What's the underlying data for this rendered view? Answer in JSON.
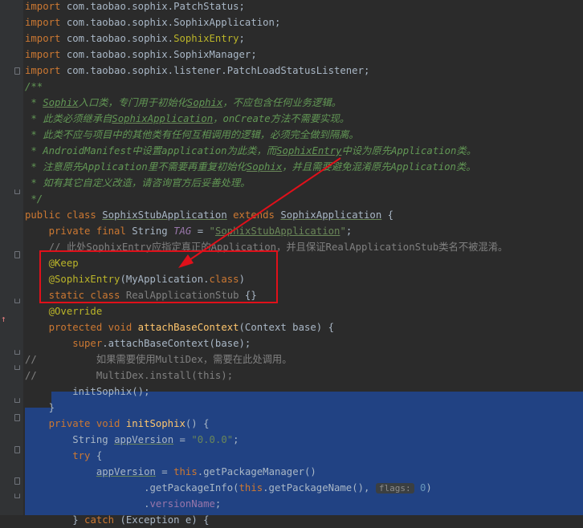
{
  "editor": {
    "lines": [
      {
        "parts": [
          [
            "kw",
            "import"
          ],
          [
            "",
            " com.taobao.sophix.PatchStatus;"
          ]
        ]
      },
      {
        "parts": [
          [
            "kw",
            "import"
          ],
          [
            "",
            " com.taobao.sophix.SophixApplication;"
          ]
        ]
      },
      {
        "parts": [
          [
            "kw",
            "import"
          ],
          [
            "",
            " com.taobao.sophix."
          ],
          [
            "ann",
            "SophixEntry"
          ],
          [
            "",
            ";"
          ]
        ]
      },
      {
        "parts": [
          [
            "kw",
            "import"
          ],
          [
            "",
            " com.taobao.sophix.SophixManager;"
          ]
        ]
      },
      {
        "parts": [
          [
            "kw",
            "import"
          ],
          [
            "",
            " com.taobao.sophix.listener.PatchLoadStatusListener;"
          ]
        ]
      },
      {
        "parts": [
          [
            "doc",
            "/**"
          ]
        ]
      },
      {
        "parts": [
          [
            "doc",
            " * "
          ],
          [
            "doc ul",
            "Sophix"
          ],
          [
            "doc",
            "入口类，专门用于初始化"
          ],
          [
            "doc ul",
            "Sophix"
          ],
          [
            "doc",
            "，不应包含任何业务逻辑。"
          ]
        ]
      },
      {
        "parts": [
          [
            "doc",
            " * 此类必须继承自"
          ],
          [
            "doc ul",
            "SophixApplication"
          ],
          [
            "doc",
            "，onCreate方法不需要实现。"
          ]
        ]
      },
      {
        "parts": [
          [
            "doc",
            " * 此类不应与项目中的其他类有任何互相调用的逻辑，必须完全做到隔离。"
          ]
        ]
      },
      {
        "parts": [
          [
            "doc",
            " * AndroidManifest中设置application为此类，而"
          ],
          [
            "doc ul",
            "SophixEntry"
          ],
          [
            "doc",
            "中设为原先Application类。"
          ]
        ]
      },
      {
        "parts": [
          [
            "doc",
            " * 注意原先Application里不需要再重复初始化"
          ],
          [
            "doc ul",
            "Sophix"
          ],
          [
            "doc",
            "，并且需要避免混淆原先Application类。"
          ]
        ]
      },
      {
        "parts": [
          [
            "doc",
            " * 如有其它自定义改造，请咨询官方后妥善处理。"
          ]
        ]
      },
      {
        "parts": [
          [
            "doc",
            " */"
          ]
        ]
      },
      {
        "parts": [
          [
            "kw",
            "public class "
          ],
          [
            "ul",
            "SophixStubApplication"
          ],
          [
            "kw",
            " extends "
          ],
          [
            "ul",
            "SophixApplication"
          ],
          [
            "",
            " {"
          ]
        ]
      },
      {
        "parts": [
          [
            "",
            "    "
          ],
          [
            "kw",
            "private final "
          ],
          [
            "",
            "String "
          ],
          [
            "fldi",
            "TAG"
          ],
          [
            "",
            " = "
          ],
          [
            "str",
            "\""
          ],
          [
            "str ul",
            "SophixStubApplication"
          ],
          [
            "str",
            "\""
          ],
          [
            "",
            ";"
          ]
        ]
      },
      {
        "parts": [
          [
            "cmt",
            "    // 此处"
          ],
          [
            "cmt ul",
            "SophixEntry"
          ],
          [
            "cmt",
            "应指定真正的Application，并且保证RealApplicationStub类名不被混淆。"
          ]
        ]
      },
      {
        "parts": [
          [
            "ann",
            "    @Keep"
          ]
        ]
      },
      {
        "parts": [
          [
            "ann",
            "    @SophixEntry"
          ],
          [
            "",
            "(MyApplication."
          ],
          [
            "kw",
            "class"
          ],
          [
            "",
            ")"
          ]
        ]
      },
      {
        "parts": [
          [
            "kw",
            "    static class "
          ],
          [
            "cmt",
            "RealApplicationStub"
          ],
          [
            "",
            " {}"
          ]
        ]
      },
      {
        "parts": [
          [
            "ann",
            "    @Override"
          ]
        ]
      },
      {
        "parts": [
          [
            "kw",
            "    protected void "
          ],
          [
            "mth",
            "attachBaseContext"
          ],
          [
            "",
            "(Context base) {"
          ]
        ]
      },
      {
        "parts": [
          [
            "kw",
            "        super"
          ],
          [
            "",
            ".attachBaseContext(base);"
          ]
        ]
      },
      {
        "parts": [
          [
            "cmt",
            "//          如果需要使用MultiDex，需要在此处调用。"
          ]
        ]
      },
      {
        "parts": [
          [
            "cmt",
            "//          MultiDex.install(this);"
          ]
        ]
      },
      {
        "parts": [
          [
            "",
            "        initSophix();"
          ]
        ]
      },
      {
        "parts": [
          [
            "",
            "    }"
          ]
        ]
      },
      {
        "parts": [
          [
            "kw",
            "    private void "
          ],
          [
            "mth",
            "initSophix"
          ],
          [
            "",
            "() {"
          ]
        ]
      },
      {
        "parts": [
          [
            "",
            "        String "
          ],
          [
            "ul",
            "appVersion"
          ],
          [
            "",
            " = "
          ],
          [
            "str",
            "\"0.0.0\""
          ],
          [
            "",
            ";"
          ]
        ]
      },
      {
        "parts": [
          [
            "kw",
            "        try"
          ],
          [
            "",
            " {"
          ]
        ]
      },
      {
        "parts": [
          [
            "",
            "            "
          ],
          [
            "ul",
            "appVersion"
          ],
          [
            "",
            " = "
          ],
          [
            "kw",
            "this"
          ],
          [
            "",
            ".getPackageManager()"
          ]
        ]
      },
      {
        "parts": [
          [
            "",
            "                    .getPackageInfo("
          ],
          [
            "kw",
            "this"
          ],
          [
            "",
            ".getPackageName(), "
          ],
          [
            "hint",
            "flags:"
          ],
          [
            "",
            " "
          ],
          [
            "num",
            "0"
          ],
          [
            "",
            ")"
          ]
        ]
      },
      {
        "parts": [
          [
            "",
            "                    ."
          ],
          [
            "fld",
            "versionName"
          ],
          [
            "",
            ";"
          ]
        ]
      },
      {
        "parts": [
          [
            "",
            "        } "
          ],
          [
            "kw",
            "catch"
          ],
          [
            "",
            " (Exception e) {"
          ]
        ]
      }
    ]
  }
}
